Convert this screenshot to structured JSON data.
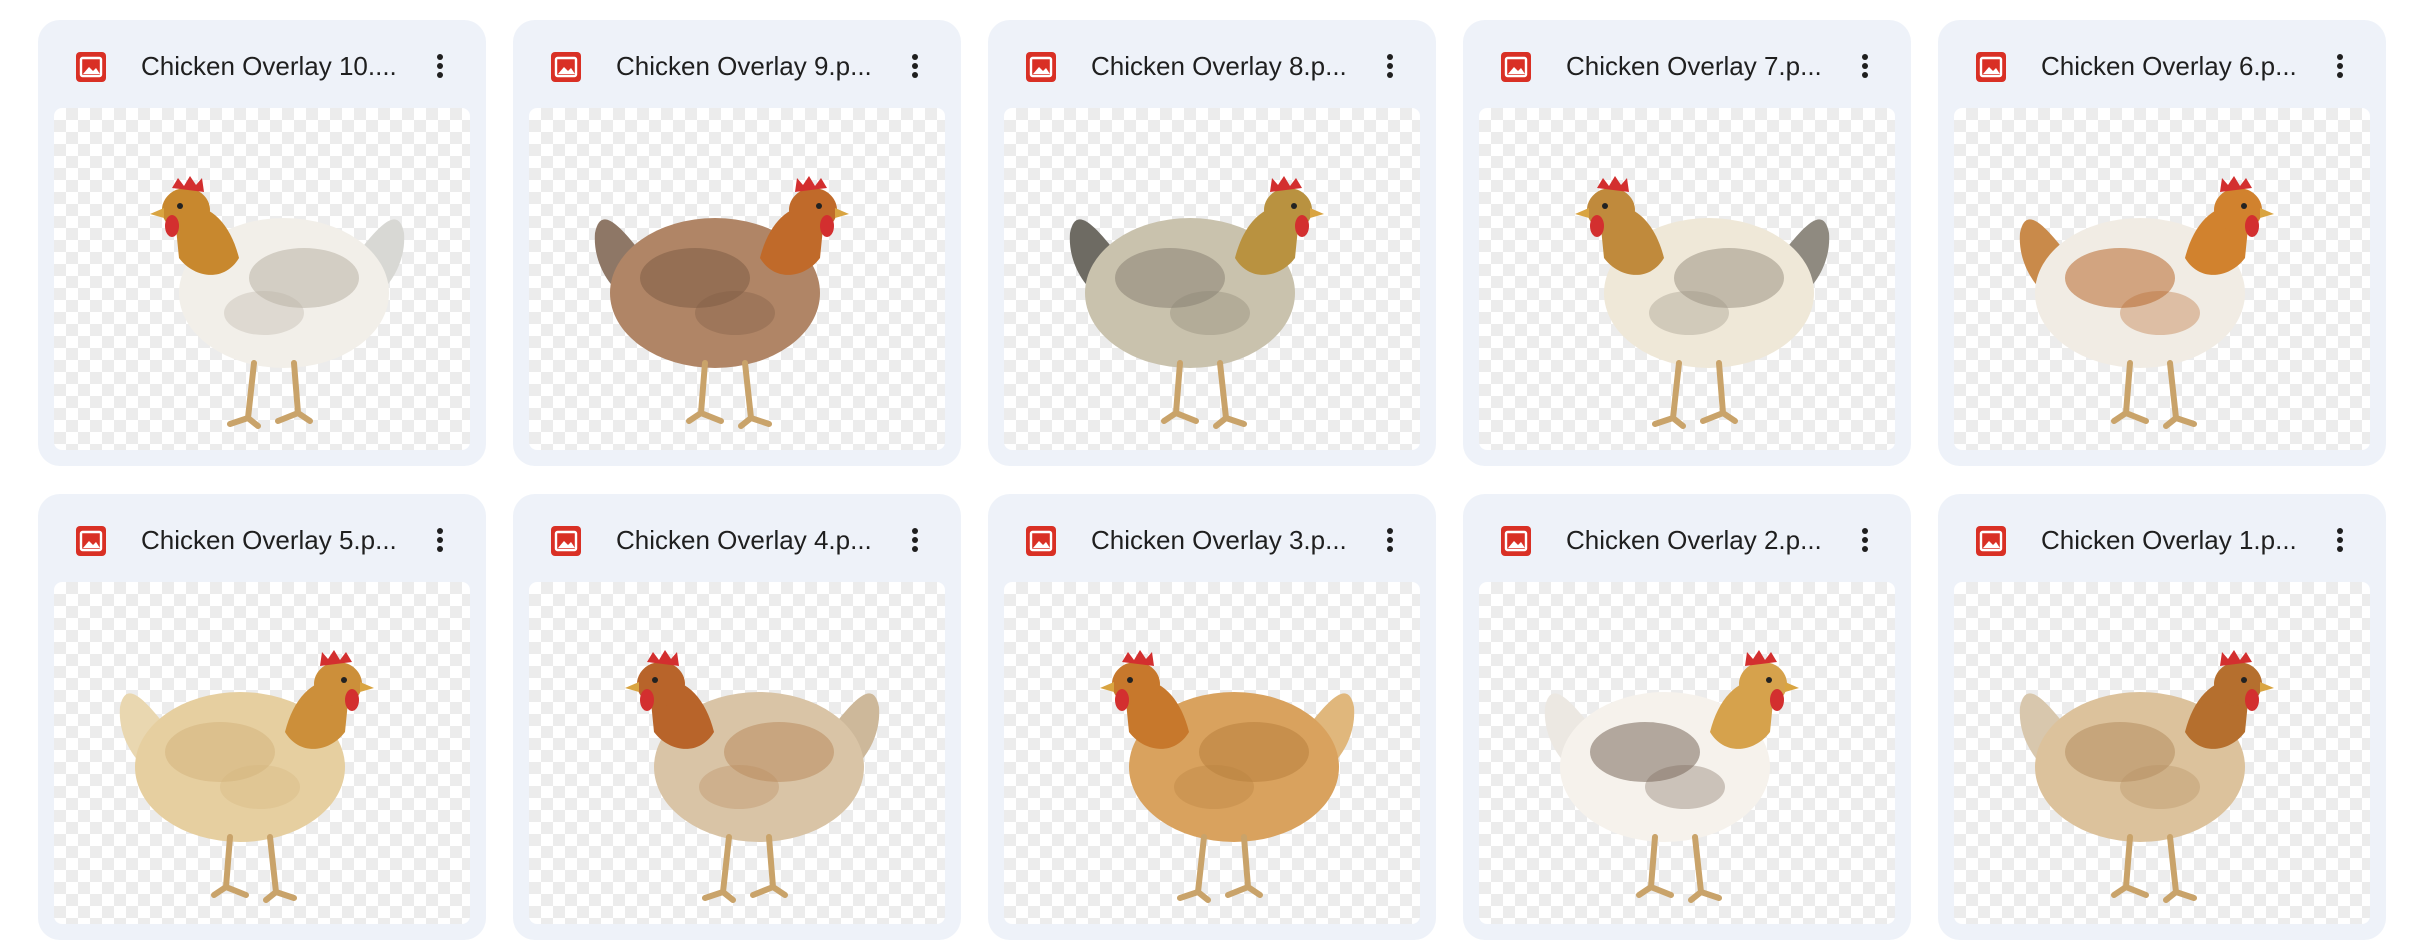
{
  "files": [
    {
      "name": "Chicken Overlay 10....",
      "icon": "image-file-icon",
      "menu_icon": "more-vert-icon",
      "palette": {
        "body": "#f2efe9",
        "neck": "#c8882e",
        "tail": "#d8d8d4",
        "spots": "#b9b3a5"
      },
      "facing": "left"
    },
    {
      "name": "Chicken Overlay 9.p...",
      "icon": "image-file-icon",
      "menu_icon": "more-vert-icon",
      "palette": {
        "body": "#b08566",
        "neck": "#c06a2a",
        "tail": "#8e7766",
        "spots": "#7f5c45"
      },
      "facing": "right"
    },
    {
      "name": "Chicken Overlay 8.p...",
      "icon": "image-file-icon",
      "menu_icon": "more-vert-icon",
      "palette": {
        "body": "#c9c2ad",
        "neck": "#b99240",
        "tail": "#6e6b63",
        "spots": "#8a8474"
      },
      "facing": "right"
    },
    {
      "name": "Chicken Overlay 7.p...",
      "icon": "image-file-icon",
      "menu_icon": "more-vert-icon",
      "palette": {
        "body": "#efe8d8",
        "neck": "#c08a3c",
        "tail": "#8f8a80",
        "spots": "#9c9385"
      },
      "facing": "left"
    },
    {
      "name": "Chicken Overlay 6.p...",
      "icon": "image-file-icon",
      "menu_icon": "more-vert-icon",
      "palette": {
        "body": "#f1ece4",
        "neck": "#d1822e",
        "tail": "#c98a4a",
        "spots": "#b86a2e"
      },
      "facing": "right"
    },
    {
      "name": "Chicken Overlay 5.p...",
      "icon": "image-file-icon",
      "menu_icon": "more-vert-icon",
      "palette": {
        "body": "#e6cfa0",
        "neck": "#cc8f3a",
        "tail": "#e9d7b0",
        "spots": "#d3b47e"
      },
      "facing": "right"
    },
    {
      "name": "Chicken Overlay 4.p...",
      "icon": "image-file-icon",
      "menu_icon": "more-vert-icon",
      "palette": {
        "body": "#d9c4a6",
        "neck": "#b8642a",
        "tail": "#cdb89a",
        "spots": "#b98d5e"
      },
      "facing": "left"
    },
    {
      "name": "Chicken Overlay 3.p...",
      "icon": "image-file-icon",
      "menu_icon": "more-vert-icon",
      "palette": {
        "body": "#d9a25e",
        "neck": "#c7782c",
        "tail": "#e0b77c",
        "spots": "#b8803e"
      },
      "facing": "left"
    },
    {
      "name": "Chicken Overlay 2.p...",
      "icon": "image-file-icon",
      "menu_icon": "more-vert-icon",
      "palette": {
        "body": "#f6f2ec",
        "neck": "#d6a24c",
        "tail": "#ece8e2",
        "spots": "#7a6a5c"
      },
      "facing": "right"
    },
    {
      "name": "Chicken Overlay 1.p...",
      "icon": "image-file-icon",
      "menu_icon": "more-vert-icon",
      "palette": {
        "body": "#dcc29c",
        "neck": "#b56f2e",
        "tail": "#d8c7ad",
        "spots": "#b48e60"
      },
      "facing": "right"
    }
  ],
  "colors": {
    "card_bg": "#eef2f9",
    "file_icon": "#d93025",
    "text": "#1f1f1f",
    "comb": "#d32f2f",
    "legs": "#c9a36a"
  }
}
